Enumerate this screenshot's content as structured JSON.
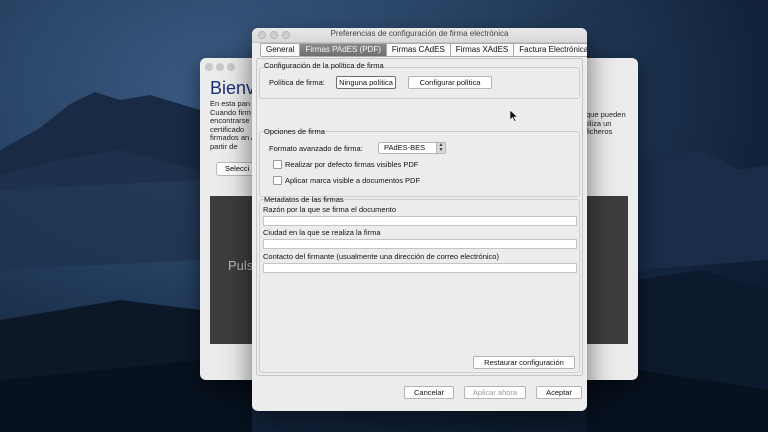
{
  "background_window": {
    "title": "Bienve",
    "intro_left": "En esta pan Cuando firm encontrarse certificado firmados an A partir de",
    "intro_right": "que pueden tiliza un ficheros",
    "select_button": "Selecci",
    "dark_panel_text": "Puls"
  },
  "dialog": {
    "title": "Preferencias de configuración de firma electrónica",
    "tabs": [
      {
        "label": "General",
        "active": false
      },
      {
        "label": "Firmas PAdES (PDF)",
        "active": true
      },
      {
        "label": "Firmas CAdES",
        "active": false
      },
      {
        "label": "Firmas XAdES",
        "active": false
      },
      {
        "label": "Factura Electrónica",
        "active": false
      }
    ],
    "policy_group": {
      "title": "Configuración de la política de firma",
      "label": "Política de firma:",
      "value": "Ninguna política",
      "configure_button": "Configurar política"
    },
    "signature_options": {
      "title": "Opciones de firma",
      "format_label": "Formato avanzado de firma:",
      "format_value": "PAdES-BES",
      "checkbox_visible_signatures": "Realizar por defecto firmas visibles PDF",
      "checkbox_visible_mark": "Aplicar marca visible a documentos PDF"
    },
    "metadata": {
      "title": "Metadatos de las firmas",
      "reason_label": "Razón por la que se firma el documento",
      "city_label": "Ciudad en la que se realiza la firma",
      "contact_label": "Contacto del firmante (usualmente una dirección de correo electrónico)"
    },
    "restore_button": "Restaurar configuración",
    "cancel_button": "Cancelar",
    "apply_button": "Aplicar ahora",
    "accept_button": "Aceptar"
  }
}
